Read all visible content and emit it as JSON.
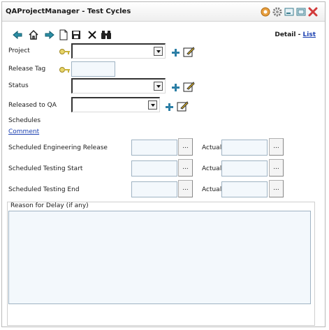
{
  "window": {
    "title": "QAProjectManager - Test Cycles"
  },
  "toolbar": {
    "icons": [
      "back-arrow-icon",
      "home-icon",
      "forward-arrow-icon",
      "new-document-icon",
      "save-icon",
      "delete-icon",
      "search-binoculars-icon"
    ]
  },
  "nav": {
    "detail_label": "Detail",
    "separator": "-",
    "list_label": "List"
  },
  "form": {
    "project_label": "Project",
    "release_tag_label": "Release Tag",
    "status_label": "Status",
    "released_to_qa_label": "Released to QA",
    "schedules_label": "Schedules",
    "comment_link": "Comment",
    "sched_eng_release_label": "Scheduled Engineering Release",
    "sched_testing_start_label": "Scheduled Testing Start",
    "sched_testing_end_label": "Scheduled Testing End",
    "actual_label": "Actual",
    "browse_label": "...",
    "reason_label": "Reason for Delay (if any)"
  },
  "colors": {
    "link": "#1a3fb0",
    "input_bg": "#f3f8fc",
    "key": "#c9b23a",
    "plus": "#2c7fa6"
  }
}
